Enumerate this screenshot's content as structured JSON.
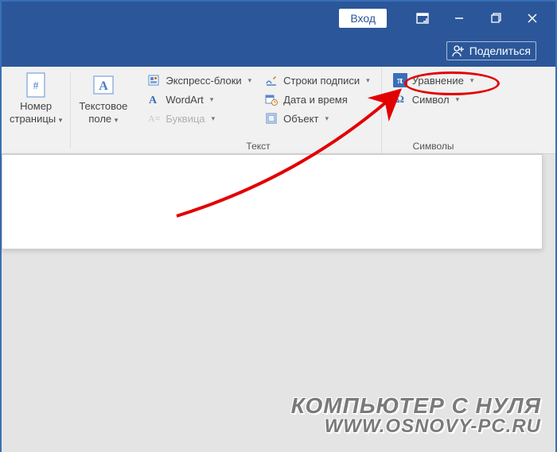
{
  "titlebar": {
    "signin": "Вход"
  },
  "sharebar": {
    "share": "Поделиться"
  },
  "ribbon": {
    "page_number": {
      "label_l1": "Номер",
      "label_l2": "страницы"
    },
    "text_box": {
      "label_l1": "Текстовое",
      "label_l2": "поле"
    },
    "text_group": {
      "label": "Текст",
      "quick_parts": "Экспресс-блоки",
      "wordart": "WordArt",
      "dropcap": "Буквица",
      "signature_line": "Строки подписи",
      "date_time": "Дата и время",
      "object": "Объект"
    },
    "symbols_group": {
      "label": "Символы",
      "equation": "Уравнение",
      "symbol": "Символ"
    }
  },
  "watermark": {
    "line1": "КОМПЬЮТЕР С НУЛЯ",
    "line2": "WWW.OSNOVY-PC.RU"
  }
}
